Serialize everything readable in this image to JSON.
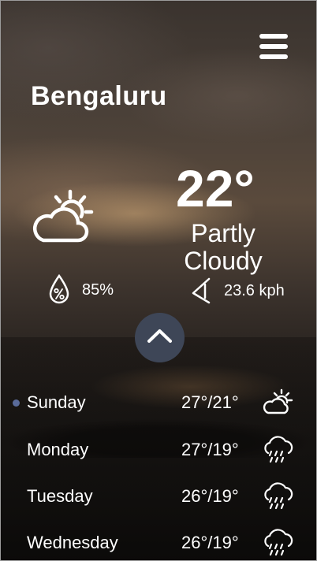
{
  "header": {
    "menu_icon": "hamburger-menu-icon"
  },
  "location": {
    "city": "Bengaluru"
  },
  "current": {
    "temperature": "22°",
    "condition": "Partly Cloudy",
    "icon": "partly-cloudy-day-icon",
    "humidity": "85%",
    "humidity_icon": "humidity-drop-icon",
    "wind": "23.6 kph",
    "wind_icon": "wind-direction-icon"
  },
  "expand_icon": "chevron-up-icon",
  "forecast": [
    {
      "day": "Sunday",
      "range": "27°/21°",
      "icon": "partly-cloudy-day-icon"
    },
    {
      "day": "Monday",
      "range": "27°/19°",
      "icon": "rain-cloud-icon"
    },
    {
      "day": "Tuesday",
      "range": "26°/19°",
      "icon": "rain-cloud-icon"
    },
    {
      "day": "Wednesday",
      "range": "26°/19°",
      "icon": "rain-cloud-icon"
    }
  ],
  "colors": {
    "expand_button": "#3e4657",
    "text": "#ffffff",
    "page_indicator": "#5a6b9a"
  }
}
